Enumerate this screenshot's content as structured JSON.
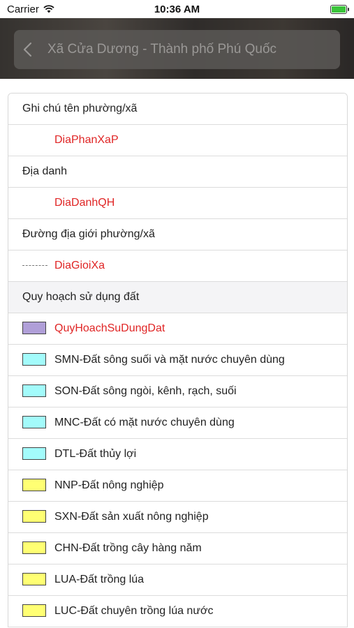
{
  "status_bar": {
    "carrier": "Carrier",
    "time": "10:36 AM"
  },
  "header": {
    "title": "Xã Cửa Dương - Thành phố Phú Quốc"
  },
  "legend": {
    "sections": [
      {
        "title": "Ghi chú tên phường/xã",
        "items": [
          {
            "label": "DiaPhanXaP",
            "symbol": "none",
            "red": true
          }
        ]
      },
      {
        "title": "Địa danh",
        "items": [
          {
            "label": "DiaDanhQH",
            "symbol": "none",
            "red": true
          }
        ]
      },
      {
        "title": "Đường địa giới phường/xã",
        "items": [
          {
            "label": "DiaGioiXa",
            "symbol": "dash",
            "red": true
          }
        ]
      },
      {
        "title": "Quy hoạch sử dụng đất",
        "items": [
          {
            "label": "QuyHoachSuDungDat",
            "symbol": "swatch",
            "color": "#b09fd8",
            "red": true
          },
          {
            "label": "SMN-Đất sông suối và mặt nước chuyên dùng",
            "symbol": "swatch",
            "color": "#a3fbfb",
            "red": false
          },
          {
            "label": "SON-Đất sông ngòi, kênh, rạch, suối",
            "symbol": "swatch",
            "color": "#a3fbfb",
            "red": false
          },
          {
            "label": "MNC-Đất có mặt nước chuyên dùng",
            "symbol": "swatch",
            "color": "#a3fbfb",
            "red": false
          },
          {
            "label": "DTL-Đất thủy lợi",
            "symbol": "swatch",
            "color": "#a3fbfb",
            "red": false
          },
          {
            "label": "NNP-Đất nông nghiệp",
            "symbol": "swatch",
            "color": "#ffff73",
            "red": false
          },
          {
            "label": "SXN-Đất sản xuất nông nghiệp",
            "symbol": "swatch",
            "color": "#ffff73",
            "red": false
          },
          {
            "label": "CHN-Đất trồng cây hàng năm",
            "symbol": "swatch",
            "color": "#ffff73",
            "red": false
          },
          {
            "label": "LUA-Đất trồng lúa",
            "symbol": "swatch",
            "color": "#ffff73",
            "red": false
          },
          {
            "label": "LUC-Đất chuyên trồng lúa nước",
            "symbol": "swatch",
            "color": "#ffff73",
            "red": false
          }
        ]
      }
    ]
  }
}
